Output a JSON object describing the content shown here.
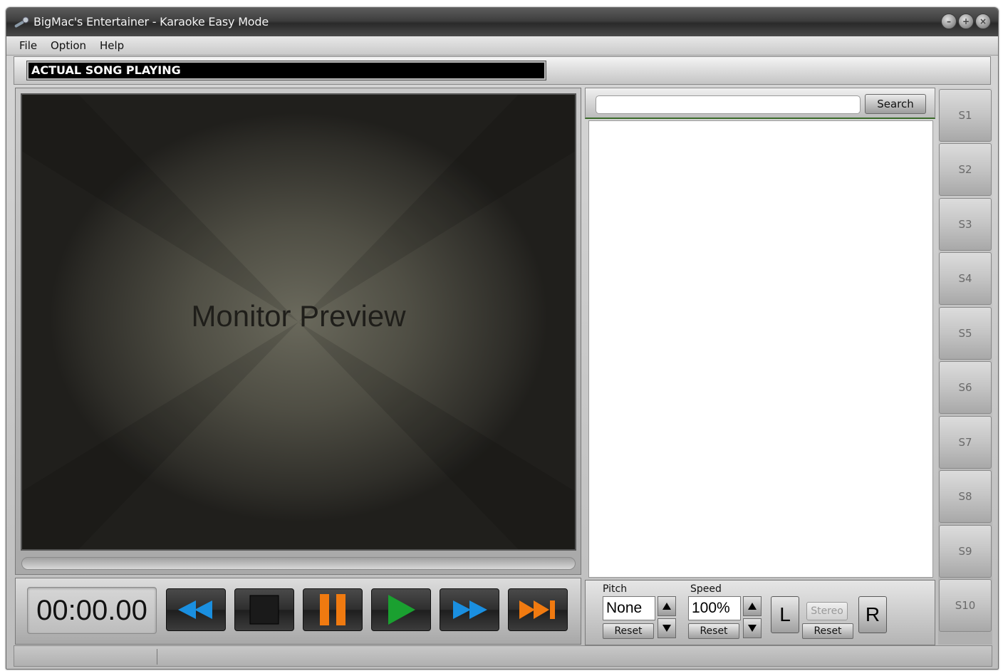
{
  "window": {
    "title": "BigMac's Entertainer  -  Karaoke Easy Mode"
  },
  "menu": {
    "items": [
      "File",
      "Option",
      "Help"
    ]
  },
  "now_playing": {
    "text": "ACTUAL SONG PLAYING"
  },
  "monitor": {
    "label": "Monitor Preview"
  },
  "transport": {
    "time": "00:00.00",
    "buttons": [
      {
        "name": "rewind",
        "icon": "rewind-icon",
        "color": "#1a8fe0"
      },
      {
        "name": "stop",
        "icon": "stop-icon",
        "color": "#1a1a1a"
      },
      {
        "name": "pause",
        "icon": "pause-icon",
        "color": "#f07a10"
      },
      {
        "name": "play",
        "icon": "play-icon",
        "color": "#1aa030"
      },
      {
        "name": "fast-forward",
        "icon": "fast-forward-icon",
        "color": "#1a8fe0"
      },
      {
        "name": "next",
        "icon": "skip-next-icon",
        "color": "#f07a10"
      }
    ]
  },
  "search": {
    "value": "",
    "button_label": "Search"
  },
  "adjust": {
    "pitch_label": "Pitch",
    "pitch_value": "None",
    "pitch_reset": "Reset",
    "speed_label": "Speed",
    "speed_value": "100%",
    "speed_reset": "Reset",
    "left_label": "L",
    "right_label": "R",
    "stereo_label": "Stereo",
    "balance_reset": "Reset"
  },
  "slots": [
    "S1",
    "S2",
    "S3",
    "S4",
    "S5",
    "S6",
    "S7",
    "S8",
    "S9",
    "S10"
  ]
}
